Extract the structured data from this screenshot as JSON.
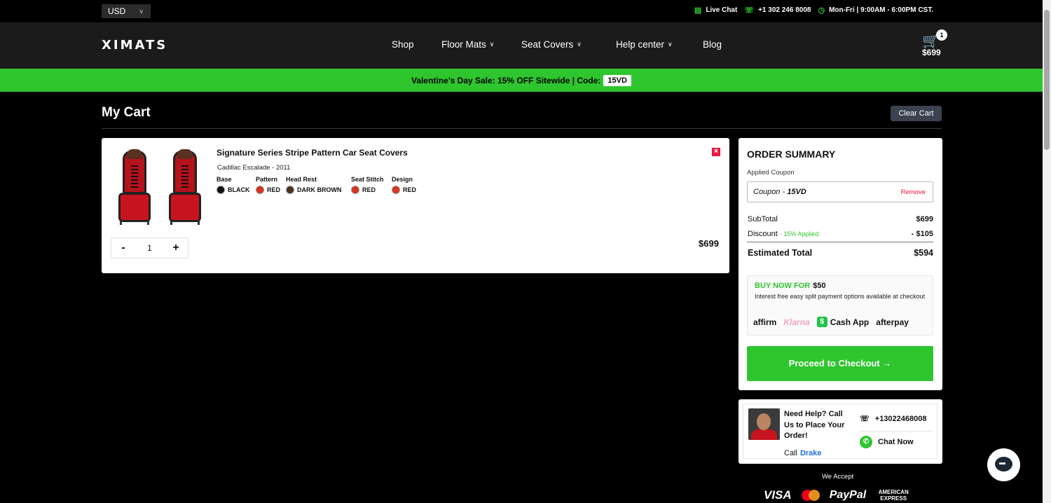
{
  "topbar": {
    "currency": "USD",
    "live_chat": "Live Chat",
    "phone": "+1 302 246 8008",
    "hours": "Mon-Fri | 9:00AM - 6:00PM CST."
  },
  "header": {
    "logo": "XIMATS",
    "nav": [
      "Shop",
      "Floor Mats",
      "Seat Covers",
      "Help center",
      "Blog"
    ],
    "cart_count": "1",
    "cart_total": "$699"
  },
  "promo": {
    "text": "Valentine’s Day Sale: 15% OFF Sitewide | Code:",
    "code": "15VD"
  },
  "page": {
    "title": "My Cart",
    "clear_cart": "Clear Cart"
  },
  "item": {
    "title": "Signature Series Stripe Pattern Car Seat Covers",
    "vehicle": "Cadillac Escalade - 2011",
    "attributes": [
      {
        "label": "Base",
        "value": "BLACK",
        "color": "#111111"
      },
      {
        "label": "Pattern",
        "value": "RED",
        "color": "#d9331f"
      },
      {
        "label": "Head Rest",
        "value": "DARK BROWN",
        "color": "#4a3322"
      },
      {
        "label": "Seat Stitch",
        "value": "RED",
        "color": "#d9331f"
      },
      {
        "label": "Design",
        "value": "RED",
        "color": "#d9331f"
      }
    ],
    "qty_minus": "-",
    "quantity": "1",
    "qty_plus": "+",
    "price": "$699"
  },
  "summary": {
    "title": "ORDER SUMMARY",
    "applied_coupon_label": "Applied Coupon",
    "coupon_prefix": "Coupon - ",
    "coupon_code": "15VD",
    "coupon_remove": "Remove",
    "subtotal_label": "SubTotal",
    "subtotal_value": "$699",
    "discount_label": "Discount",
    "discount_note": "- 15% Applied",
    "discount_value": "- $105",
    "estimated_label": "Estimated Total",
    "estimated_value": "$594",
    "buy_now_label": "BUY NOW FOR",
    "buy_now_amount": "$50",
    "buy_now_desc": "Interest free easy split payment options available at checkout",
    "pay_options": [
      "affirm",
      "Klarna",
      "Cash App",
      "afterpay"
    ],
    "checkout": "Proceed to Checkout"
  },
  "help": {
    "text": "Need Help? Call Us to Place Your Order!",
    "call_label": "Call",
    "agent": "Drake",
    "phone": "+13022468008",
    "chat": "Chat Now"
  },
  "footer": {
    "we_accept": "We Accept",
    "cards": [
      "VISA",
      "PayPal",
      "AMERICAN EXPRESS"
    ]
  }
}
